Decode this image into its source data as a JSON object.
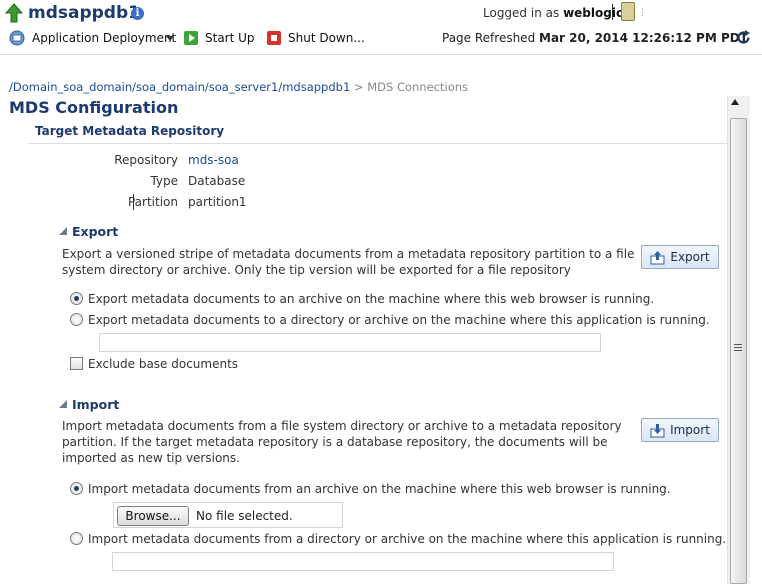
{
  "header": {
    "app_name": "mdsappdb1",
    "logged_in_prefix": "Logged in as",
    "username": "weblogic",
    "menu": {
      "app_deployment": "Application Deployment",
      "start_up": "Start Up",
      "shut_down": "Shut Down..."
    },
    "refresh_prefix": "Page Refreshed",
    "refresh_time": "Mar 20, 2014 12:26:12 PM PDT"
  },
  "breadcrumb": {
    "path": "/Domain_soa_domain/soa_domain/soa_server1/mdsappdb1",
    "separator": ">",
    "current": "MDS Connections"
  },
  "page": {
    "title": "MDS Configuration",
    "section": "Target Metadata Repository",
    "repository_label": "Repository",
    "repository_value": "mds-soa",
    "type_label": "Type",
    "type_value": "Database",
    "partition_label": "Partition",
    "partition_value": "partition1"
  },
  "export": {
    "title": "Export",
    "description": "Export a versioned stripe of metadata documents from a metadata repository partition to a file system directory or archive. Only the tip version will be exported for a file repository",
    "button": "Export",
    "option1": "Export metadata documents to an archive on the machine where this web browser is running.",
    "option2": "Export metadata documents to a directory or archive on the machine where this application is running.",
    "selected_option": 1,
    "exclude_label": "Exclude base documents",
    "exclude_checked": false
  },
  "import": {
    "title": "Import",
    "description": "Import metadata documents from a file system directory or archive to a metadata repository partition. If the target metadata repository is a database repository, the documents will be imported as new tip versions.",
    "button": "Import",
    "option1": "Import metadata documents from an archive on the machine where this web browser is running.",
    "option2": "Import metadata documents from a directory or archive on the machine where this application is running.",
    "selected_option": 1,
    "browse_button": "Browse...",
    "no_file": "No file selected."
  }
}
